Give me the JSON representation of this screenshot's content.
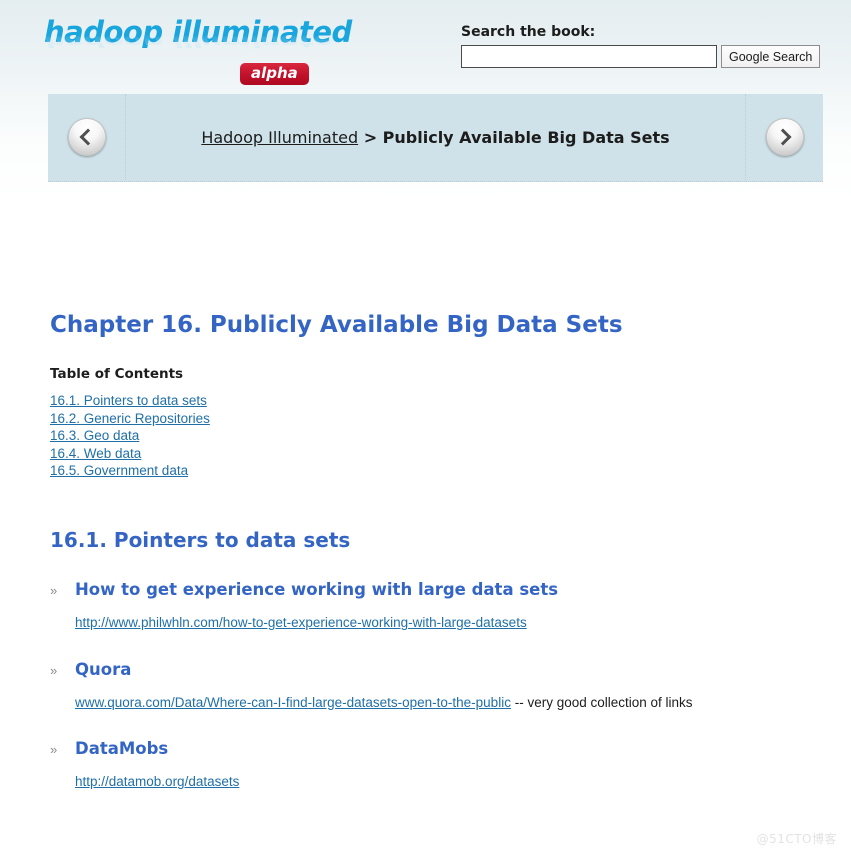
{
  "site": {
    "logo_text": "hadoop illuminated",
    "badge": "alpha"
  },
  "search": {
    "label": "Search the book:",
    "value": "",
    "placeholder": "",
    "button_label": "Google Search"
  },
  "nav": {
    "prev_icon": "chevron-left-icon",
    "next_icon": "chevron-right-icon",
    "breadcrumb_parent": "Hadoop Illuminated",
    "breadcrumb_separator": " > ",
    "breadcrumb_current": "Publicly Available Big Data Sets"
  },
  "main": {
    "chapter_title": "Chapter 16. Publicly Available Big Data Sets",
    "toc_title": "Table of Contents",
    "toc": [
      {
        "label": "16.1. Pointers to data sets"
      },
      {
        "label": "16.2. Generic Repositories"
      },
      {
        "label": "16.3. Geo data"
      },
      {
        "label": "16.4. Web data"
      },
      {
        "label": "16.5. Government data"
      }
    ],
    "section_title": "16.1. Pointers to data sets",
    "bullet_glyph": "»",
    "entries": [
      {
        "name": "How to get experience working with large data sets",
        "link": "http://www.philwhln.com/how-to-get-experience-working-with-large-datasets",
        "note": ""
      },
      {
        "name": "Quora",
        "link": "www.quora.com/Data/Where-can-I-find-large-datasets-open-to-the-public",
        "note": " -- very good collection of links"
      },
      {
        "name": "DataMobs",
        "link": "http://datamob.org/datasets",
        "note": ""
      }
    ]
  },
  "watermark": "@51CTO博客",
  "colors": {
    "heading_blue": "#3465c4",
    "link_blue": "#1f6fa8",
    "logo_cyan": "#19a5dd",
    "badge_red": "#c2102a",
    "navband_blue": "#cfe2e9"
  }
}
